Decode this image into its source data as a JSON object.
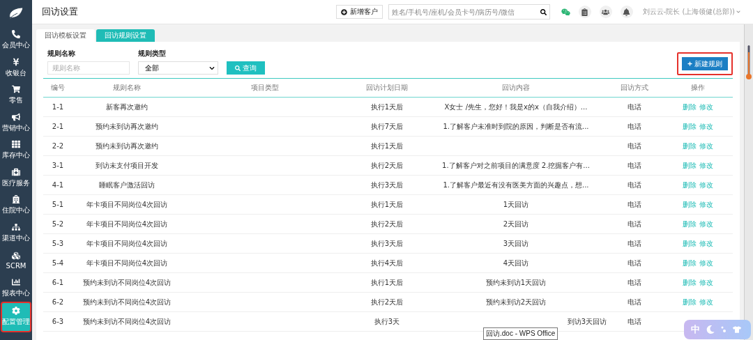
{
  "sidebar": {
    "items": [
      {
        "label": "会员中心",
        "selected": false,
        "highlighted": false
      },
      {
        "label": "收银台",
        "selected": false,
        "highlighted": false
      },
      {
        "label": "零售",
        "selected": false,
        "highlighted": false
      },
      {
        "label": "营销中心",
        "selected": false,
        "highlighted": false
      },
      {
        "label": "库存中心",
        "selected": false,
        "highlighted": false
      },
      {
        "label": "医疗服务",
        "selected": false,
        "highlighted": false
      },
      {
        "label": "住院中心",
        "selected": false,
        "highlighted": false
      },
      {
        "label": "渠道中心",
        "selected": false,
        "highlighted": false
      },
      {
        "label": "SCRM",
        "selected": false,
        "highlighted": false
      },
      {
        "label": "报表中心",
        "selected": false,
        "highlighted": false
      },
      {
        "label": "配置管理",
        "selected": true,
        "highlighted": true
      }
    ]
  },
  "header": {
    "title": "回访设置",
    "new_customer_button": "新增客户",
    "search": {
      "placeholder": "姓名/手机号/座机/会员卡号/病历号/微信"
    },
    "user": "刘云云-院长 (上海领健(总部))"
  },
  "tabs": [
    {
      "label": "回访模板设置",
      "selected": false
    },
    {
      "label": "回访规则设置",
      "selected": true
    }
  ],
  "filters": {
    "name_label": "规则名称",
    "name_placeholder": "规则名称",
    "type_label": "规则类型",
    "type_value": "全部",
    "query_button": "查询"
  },
  "new_rule_button": {
    "label": "新建规则",
    "highlighted": true
  },
  "table": {
    "columns": [
      "编号",
      "规则名称",
      "项目类型",
      "回访计划日期",
      "回访内容",
      "回访方式",
      "操作"
    ],
    "rows": [
      {
        "id": "1-1",
        "name": "新客再次邀约",
        "plan": "执行1天后",
        "content": "X女士 /先生，您好！我是x的x（自我介绍）...",
        "method": "电话",
        "actions": [
          "删除",
          "修改"
        ]
      },
      {
        "id": "2-1",
        "name": "预约未到访再次邀约",
        "plan": "执行7天后",
        "content": "1.了解客户未准时到院的原因，判断是否有流...",
        "method": "电话",
        "actions": [
          "删除",
          "修改"
        ]
      },
      {
        "id": "2-2",
        "name": "预约未到访再次邀约",
        "plan": "执行1天后",
        "method": "电话",
        "actions": [
          "删除",
          "修改"
        ]
      },
      {
        "id": "3-1",
        "name": "到访未支付项目开发",
        "plan": "执行2天后",
        "content": "1.了解客户对之前项目的满意度 2.挖掘客户有...",
        "method": "电话",
        "actions": [
          "删除",
          "修改"
        ]
      },
      {
        "id": "4-1",
        "name": "睡眠客户激活回访",
        "plan": "执行3天后",
        "content": "1.了解客户最近有没有医美方面的兴趣点，想...",
        "method": "电话",
        "actions": [
          "删除",
          "修改"
        ]
      },
      {
        "id": "5-1",
        "name": "年卡项目不同岗位4次回访",
        "plan": "执行1天后",
        "content": "1天回访",
        "method": "电话",
        "actions": [
          "删除",
          "修改"
        ]
      },
      {
        "id": "5-2",
        "name": "年卡项目不同岗位4次回访",
        "plan": "执行2天后",
        "content": "2天回访",
        "method": "电话",
        "actions": [
          "删除",
          "修改"
        ]
      },
      {
        "id": "5-3",
        "name": "年卡项目不同岗位4次回访",
        "plan": "执行3天后",
        "content": "3天回访",
        "method": "电话",
        "actions": [
          "删除",
          "修改"
        ]
      },
      {
        "id": "5-4",
        "name": "年卡项目不同岗位4次回访",
        "plan": "执行4天后",
        "content": "4天回访",
        "method": "电话",
        "actions": [
          "删除",
          "修改"
        ]
      },
      {
        "id": "6-1",
        "name": "预约未到访不同岗位4次回访",
        "plan": "执行1天后",
        "content": "预约未到访1天回访",
        "method": "电话",
        "actions": [
          "删除",
          "修改"
        ]
      },
      {
        "id": "6-2",
        "name": "预约未到访不同岗位4次回访",
        "plan": "执行2天后",
        "content": "预约未到访2天回访",
        "method": "电话",
        "actions": [
          "删除",
          "修改"
        ]
      },
      {
        "id": "6-3",
        "name": "预约未到访不同岗位4次回访",
        "plan": "执行3天",
        "content": "到访3天回访",
        "method": "电话"
      }
    ]
  },
  "tooltip": "回访.doc - WPS Office",
  "ime_toolbar": {
    "mode": "中"
  }
}
